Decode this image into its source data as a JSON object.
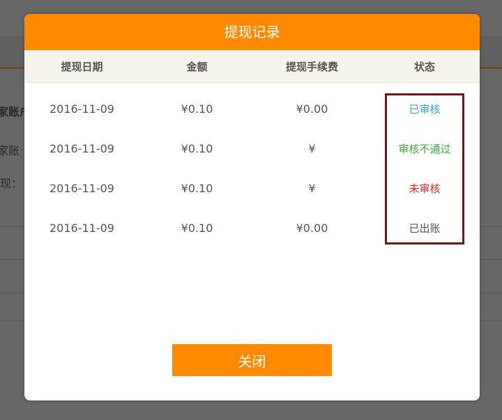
{
  "background": {
    "snippets": [
      "家账户",
      "家账",
      "现："
    ]
  },
  "modal": {
    "title": "提现记录",
    "columns": [
      "提现日期",
      "金额",
      "提现手续费",
      "状态"
    ],
    "rows": [
      {
        "date": "2016-11-09",
        "amount": "¥0.10",
        "fee": "¥0.00",
        "status": "已审核",
        "status_color": "#3aa0d8"
      },
      {
        "date": "2016-11-09",
        "amount": "¥0.10",
        "fee": "¥",
        "status": "审核不通过",
        "status_color": "#3db13d"
      },
      {
        "date": "2016-11-09",
        "amount": "¥0.10",
        "fee": "¥",
        "status": "未审核",
        "status_color": "#ee2b22"
      },
      {
        "date": "2016-11-09",
        "amount": "¥0.10",
        "fee": "¥0.00",
        "status": "已出账",
        "status_color": "#555555"
      }
    ],
    "close_label": "关闭"
  },
  "colors": {
    "accent": "#ff8a00",
    "highlight_border": "#7a1416"
  }
}
